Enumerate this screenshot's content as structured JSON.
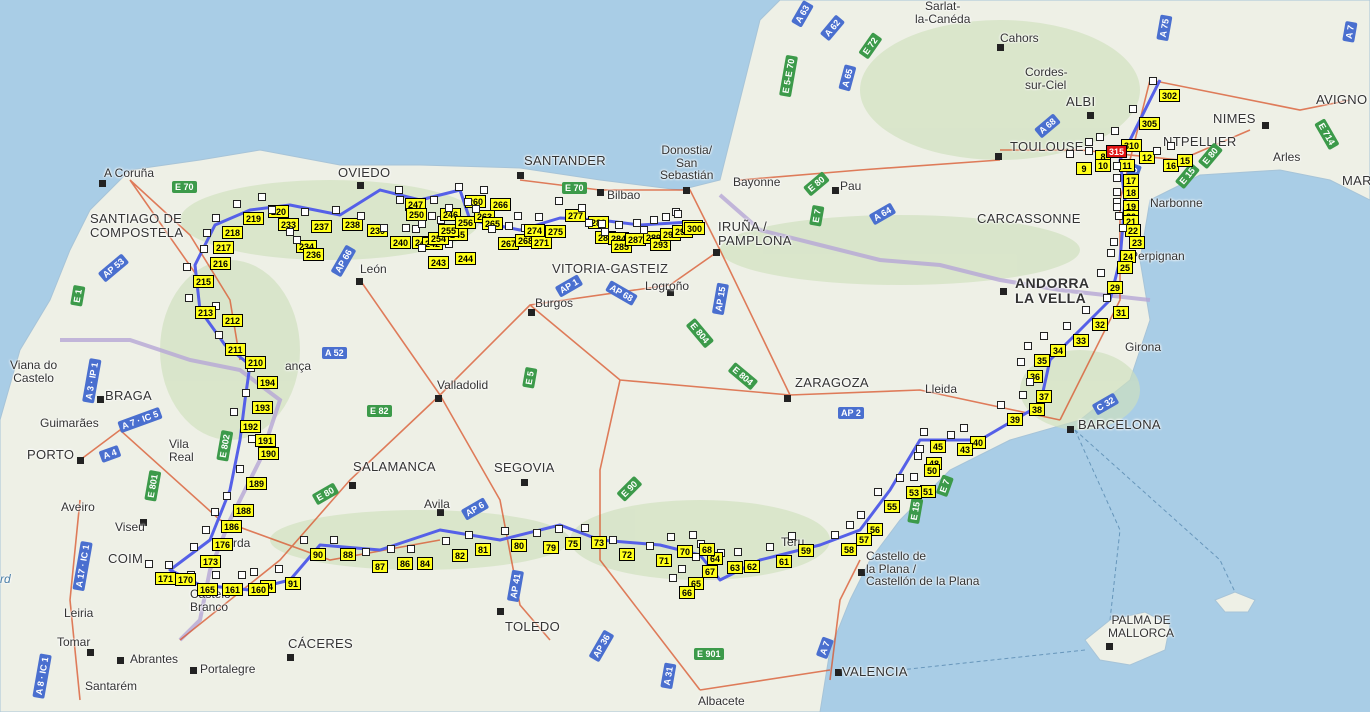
{
  "map": {
    "colors": {
      "sea": "#a9cde6",
      "land": "#eef0e6",
      "hills": "#cfe0bd",
      "route": "#5560e8",
      "road": "#d9542b",
      "border": "#b5a6d6",
      "waypoint": "#ffff1a",
      "end": "#e01515"
    },
    "cities": [
      {
        "id": "a-coruna",
        "label": "A Coruña"
      },
      {
        "id": "santiago",
        "label": "SANTIAGO DE\nCOMPOSTELA"
      },
      {
        "id": "oviedo",
        "label": "OVIEDO"
      },
      {
        "id": "santander",
        "label": "SANTANDER"
      },
      {
        "id": "bilbao",
        "label": "Bilbao"
      },
      {
        "id": "donostia",
        "label": "Donostia/\nSan\nSebastián"
      },
      {
        "id": "bayonne",
        "label": "Bayonne"
      },
      {
        "id": "pau",
        "label": "Pau"
      },
      {
        "id": "iruna",
        "label": "IRUÑA /\nPAMPLONA"
      },
      {
        "id": "vitoria",
        "label": "VITORIA-GASTEIZ"
      },
      {
        "id": "leon",
        "label": "León"
      },
      {
        "id": "burgos",
        "label": "Burgos"
      },
      {
        "id": "logrono",
        "label": "Logroño"
      },
      {
        "id": "valladolid",
        "label": "Valladolid"
      },
      {
        "id": "zaragoza",
        "label": "ZARAGOZA"
      },
      {
        "id": "lleida",
        "label": "Lleida"
      },
      {
        "id": "andorra",
        "label": "ANDORRA\nLA VELLA"
      },
      {
        "id": "barcelona",
        "label": "BARCELONA"
      },
      {
        "id": "girona",
        "label": "Girona"
      },
      {
        "id": "perpignan",
        "label": "Perpignan"
      },
      {
        "id": "narbonne",
        "label": "Narbonne"
      },
      {
        "id": "carcassonne",
        "label": "CARCASSONNE"
      },
      {
        "id": "toulouse",
        "label": "TOULOUSE"
      },
      {
        "id": "albi",
        "label": "ALBI"
      },
      {
        "id": "cordes",
        "label": "Cordes-\nsur-Ciel"
      },
      {
        "id": "cahors",
        "label": "Cahors"
      },
      {
        "id": "sarlat",
        "label": "Sarlat-\nla-Canéda"
      },
      {
        "id": "nimes",
        "label": "NIMES"
      },
      {
        "id": "avignon",
        "label": "AVIGNO"
      },
      {
        "id": "arles",
        "label": "Arles"
      },
      {
        "id": "montpellier",
        "label": "NTPELLIER"
      },
      {
        "id": "mar",
        "label": "MAR"
      },
      {
        "id": "braga",
        "label": "BRAGA"
      },
      {
        "id": "viana",
        "label": "Viana do\nCastelo"
      },
      {
        "id": "guimaraes",
        "label": "Guimarães"
      },
      {
        "id": "porto",
        "label": "PORTO"
      },
      {
        "id": "vila-real",
        "label": "Vila\nReal"
      },
      {
        "id": "aveiro",
        "label": "Aveiro"
      },
      {
        "id": "viseu",
        "label": "Viseu"
      },
      {
        "id": "coimbra",
        "label": "COIM"
      },
      {
        "id": "leiria",
        "label": "Leiria"
      },
      {
        "id": "tomar",
        "label": "Tomar"
      },
      {
        "id": "abrantes",
        "label": "Abrantes"
      },
      {
        "id": "santarem",
        "label": "Santarém"
      },
      {
        "id": "castelo-branco",
        "label": "Castelo\nBranco"
      },
      {
        "id": "portalegre",
        "label": "Portalegre"
      },
      {
        "id": "caceres",
        "label": "CÁCERES"
      },
      {
        "id": "salamanca",
        "label": "SALAMANCA"
      },
      {
        "id": "segovia",
        "label": "SEGOVIA"
      },
      {
        "id": "avila",
        "label": "Avila"
      },
      {
        "id": "toledo",
        "label": "TOLEDO"
      },
      {
        "id": "teruel",
        "label": "Teru"
      },
      {
        "id": "castellon",
        "label": "Castello de\nla Plana /\nCastellón de la Plana"
      },
      {
        "id": "valencia",
        "label": "VALENCIA"
      },
      {
        "id": "palma",
        "label": "PALMA DE\nMALLORCA"
      },
      {
        "id": "albacete",
        "label": "Albacete"
      },
      {
        "id": "braganca",
        "label": "ança"
      },
      {
        "id": "guarda",
        "label": "rda"
      },
      {
        "id": "rd",
        "label": "rd"
      }
    ],
    "roads": [
      "A 63",
      "A 62",
      "E 72",
      "A 65",
      "E 5-E 70",
      "A 75",
      "A 68",
      "E 70",
      "E 80",
      "E 7",
      "A 64",
      "A 9",
      "E 15",
      "E 80",
      "A 7",
      "A 1",
      "E 70",
      "E 70",
      "AP 66",
      "AP 1",
      "AP 68",
      "AP 15",
      "E 804",
      "E 804",
      "AP 2",
      "C 32",
      "E 82",
      "A 52",
      "AP 53",
      "E 1",
      "A 3 · IP 1",
      "A 7 · IC 5",
      "A 4",
      "E 801",
      "E 802",
      "E 80",
      "A 1",
      "A 17 · IC 1",
      "A 8 · IC 1",
      "E 90",
      "AP 6",
      "E 5",
      "AP 41",
      "AP 36",
      "E 901",
      "A 31",
      "E 15",
      "E 80",
      "E 7",
      "A 7",
      "E 90",
      "E 714"
    ],
    "route_labels": [
      "4",
      "5",
      "6",
      "7",
      "8",
      "9",
      "10",
      "11",
      "12",
      "16",
      "15",
      "17",
      "18",
      "19",
      "20",
      "21",
      "22",
      "23",
      "24",
      "25",
      "29",
      "31",
      "32",
      "33",
      "34",
      "35",
      "36",
      "37",
      "38",
      "39",
      "40",
      "43",
      "45",
      "48",
      "50",
      "51",
      "53",
      "55",
      "56",
      "57",
      "58",
      "59",
      "61",
      "62",
      "63",
      "64",
      "65",
      "66",
      "67",
      "68",
      "70",
      "71",
      "72",
      "73",
      "75",
      "79",
      "80",
      "81",
      "82",
      "84",
      "86",
      "87",
      "88",
      "90",
      "91",
      "94",
      "160",
      "161",
      "165",
      "170",
      "171",
      "173",
      "176",
      "186",
      "188",
      "189",
      "190",
      "191",
      "192",
      "193",
      "194",
      "210",
      "211",
      "212",
      "213",
      "215",
      "216",
      "217",
      "218",
      "219",
      "220",
      "233",
      "234",
      "236",
      "237",
      "238",
      "239",
      "240",
      "241",
      "242",
      "243",
      "244",
      "245",
      "246",
      "247",
      "250",
      "254",
      "255",
      "256",
      "260",
      "263",
      "265",
      "266",
      "267",
      "268",
      "271",
      "274",
      "275",
      "277",
      "280",
      "282",
      "284",
      "285",
      "287",
      "289",
      "293",
      "294",
      "295",
      "299",
      "300",
      "302",
      "305",
      "310",
      "315"
    ]
  }
}
